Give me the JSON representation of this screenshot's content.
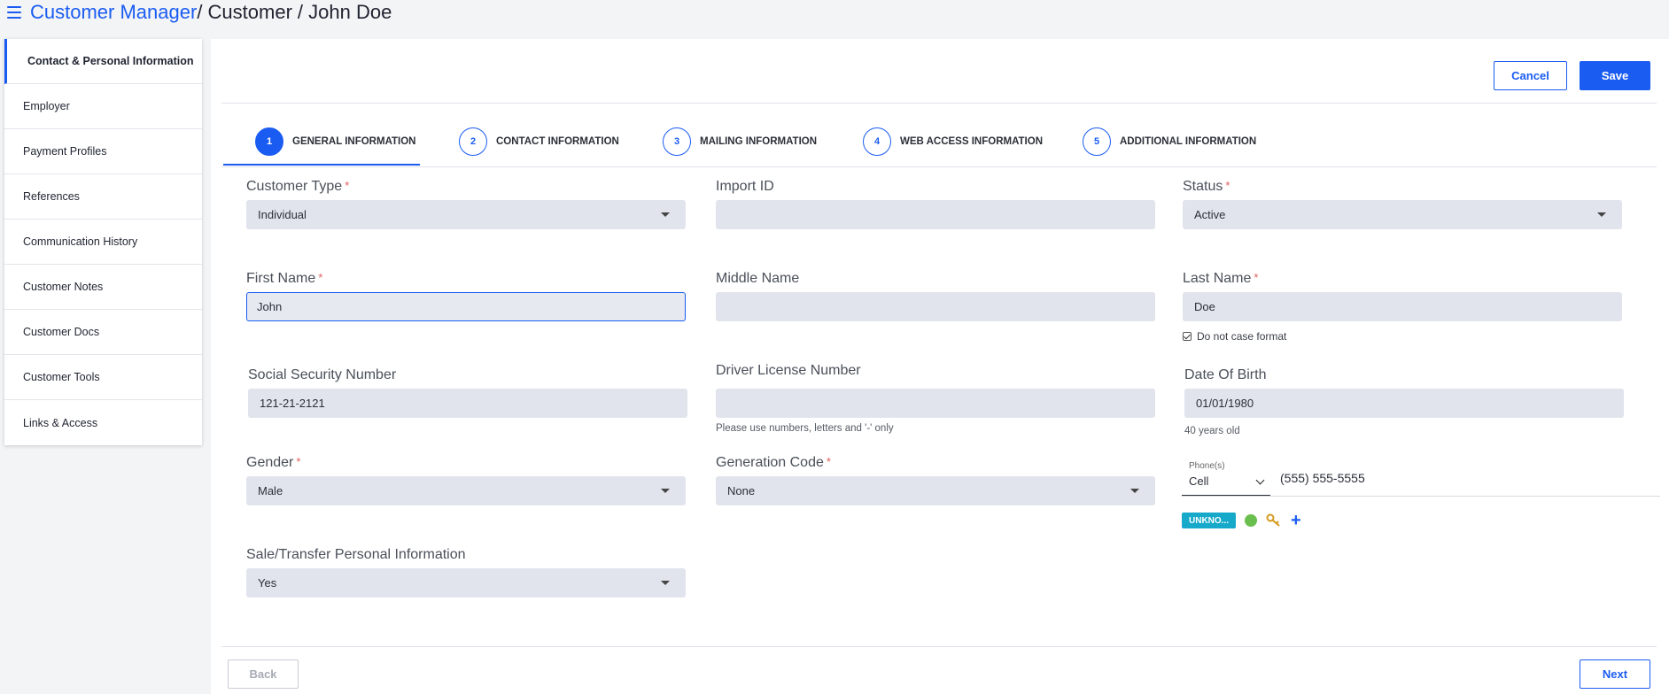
{
  "breadcrumb": {
    "root": "Customer Manager",
    "level2": "/ Customer",
    "level3": "/ John Doe"
  },
  "sidebar": {
    "items": [
      {
        "label": "Contact & Personal Information",
        "active": true
      },
      {
        "label": "Employer"
      },
      {
        "label": "Payment Profiles"
      },
      {
        "label": "References"
      },
      {
        "label": "Communication History"
      },
      {
        "label": "Customer Notes"
      },
      {
        "label": "Customer Docs"
      },
      {
        "label": "Customer Tools"
      },
      {
        "label": "Links & Access"
      }
    ]
  },
  "toolbar": {
    "cancel_label": "Cancel",
    "save_label": "Save"
  },
  "steps": [
    {
      "num": "1",
      "label": "GENERAL INFORMATION",
      "active": true
    },
    {
      "num": "2",
      "label": "CONTACT INFORMATION"
    },
    {
      "num": "3",
      "label": "MAILING INFORMATION"
    },
    {
      "num": "4",
      "label": "WEB ACCESS INFORMATION"
    },
    {
      "num": "5",
      "label": "ADDITIONAL INFORMATION"
    }
  ],
  "form": {
    "customer_type": {
      "label": "Customer Type",
      "value": "Individual"
    },
    "import_id": {
      "label": "Import ID",
      "value": ""
    },
    "status": {
      "label": "Status",
      "value": "Active"
    },
    "first_name": {
      "label": "First Name",
      "value": "John"
    },
    "middle_name": {
      "label": "Middle Name",
      "value": ""
    },
    "last_name": {
      "label": "Last Name",
      "value": "Doe"
    },
    "case_format": {
      "label": "Do not case format"
    },
    "ssn": {
      "label": "Social Security Number",
      "value": "121-21-2121"
    },
    "driver_license": {
      "label": "Driver License Number",
      "value": "",
      "hint": "Please use numbers, letters and '-' only"
    },
    "dob": {
      "label": "Date Of Birth",
      "value": "01/01/1980",
      "hint": "40 years old"
    },
    "gender": {
      "label": "Gender",
      "value": "Male"
    },
    "generation_code": {
      "label": "Generation Code",
      "value": "None"
    },
    "sale_transfer": {
      "label": "Sale/Transfer Personal Information",
      "value": "Yes"
    },
    "required_mark": "*"
  },
  "phone": {
    "mini_label": "Phone(s)",
    "type": "Cell",
    "number": "(555) 555-5555",
    "badge": "UNKNO...",
    "status_color": "#6bbf4e"
  },
  "footer": {
    "back_label": "Back",
    "next_label": "Next"
  },
  "colors": {
    "accent": "#1a5cf2",
    "badge": "#16a9c9",
    "required": "#e05c5c"
  }
}
